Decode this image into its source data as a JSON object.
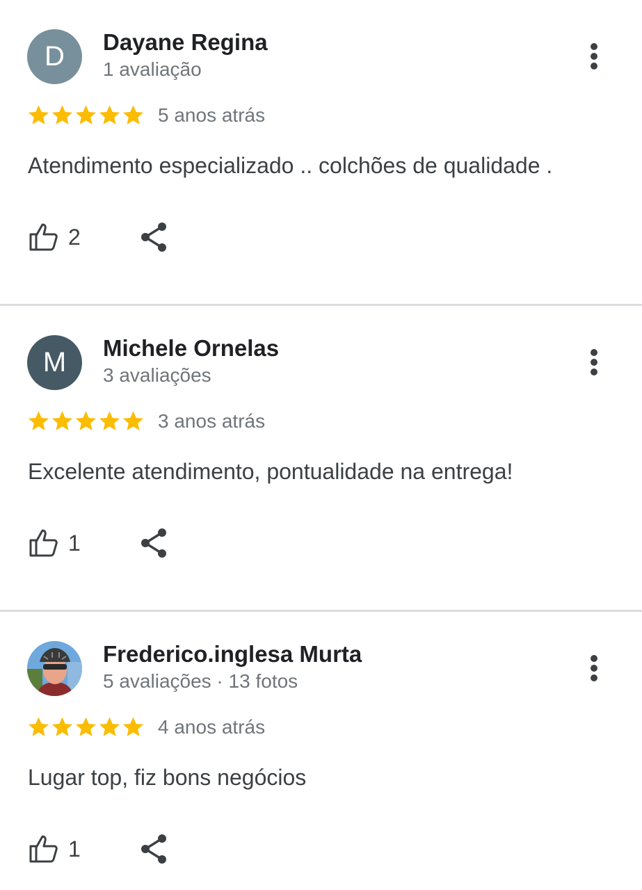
{
  "colors": {
    "star": "#fbbc04",
    "avatar_d": "#78909c",
    "avatar_m": "#455a64",
    "divider": "#dadce0"
  },
  "reviews": [
    {
      "avatar_letter": "D",
      "avatar_color": "#78909c",
      "name": "Dayane Regina",
      "meta": "1 avaliação",
      "rating": 5,
      "time": "5 anos atrás",
      "text": "Atendimento especializado .. colchões de qualidade .",
      "likes": "2"
    },
    {
      "avatar_letter": "M",
      "avatar_color": "#455a64",
      "name": "Michele Ornelas",
      "meta": "3 avaliações",
      "rating": 5,
      "time": "3 anos atrás",
      "text": "Excelente atendimento, pontualidade na entrega!",
      "likes": "1"
    },
    {
      "avatar_letter": "",
      "avatar_color": "#6fa8dc",
      "name": "Frederico.inglesa Murta",
      "meta": "5 avaliações · 13 fotos",
      "rating": 5,
      "time": "4 anos atrás",
      "text": "Lugar top, fiz bons negócios",
      "likes": "1"
    }
  ]
}
